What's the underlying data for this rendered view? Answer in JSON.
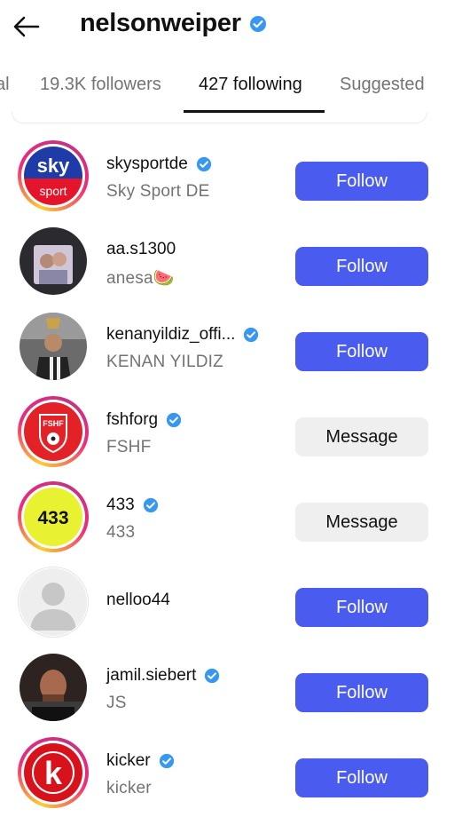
{
  "header": {
    "title": "nelsonweiper"
  },
  "tabs": [
    {
      "label": "al"
    },
    {
      "label": "19.3K followers"
    },
    {
      "label": "427 following"
    },
    {
      "label": "Suggested"
    }
  ],
  "colors": {
    "accent": "#4a5bef",
    "verified": "#3897f0"
  },
  "accounts": [
    {
      "username": "skysportde",
      "name": "Sky Sport DE",
      "verified": true,
      "button": "Follow"
    },
    {
      "username": "aa.s1300",
      "name": "anesa🍉",
      "verified": false,
      "button": "Follow"
    },
    {
      "username": "kenanyildiz_offi...",
      "name": "KENAN YILDIZ",
      "verified": true,
      "button": "Follow"
    },
    {
      "username": "fshforg",
      "name": "FSHF",
      "verified": true,
      "button": "Message"
    },
    {
      "username": "433",
      "name": "433",
      "verified": true,
      "button": "Message"
    },
    {
      "username": "nelloo44",
      "name": "",
      "verified": false,
      "button": "Follow"
    },
    {
      "username": "jamil.siebert",
      "name": "JS",
      "verified": true,
      "button": "Follow"
    },
    {
      "username": "kicker",
      "name": "kicker",
      "verified": true,
      "button": "Follow"
    }
  ],
  "logos": {
    "sky_top": "sky",
    "sky_bottom": "sport",
    "fshf": "FSHF",
    "a433": "433",
    "kicker": "k"
  }
}
